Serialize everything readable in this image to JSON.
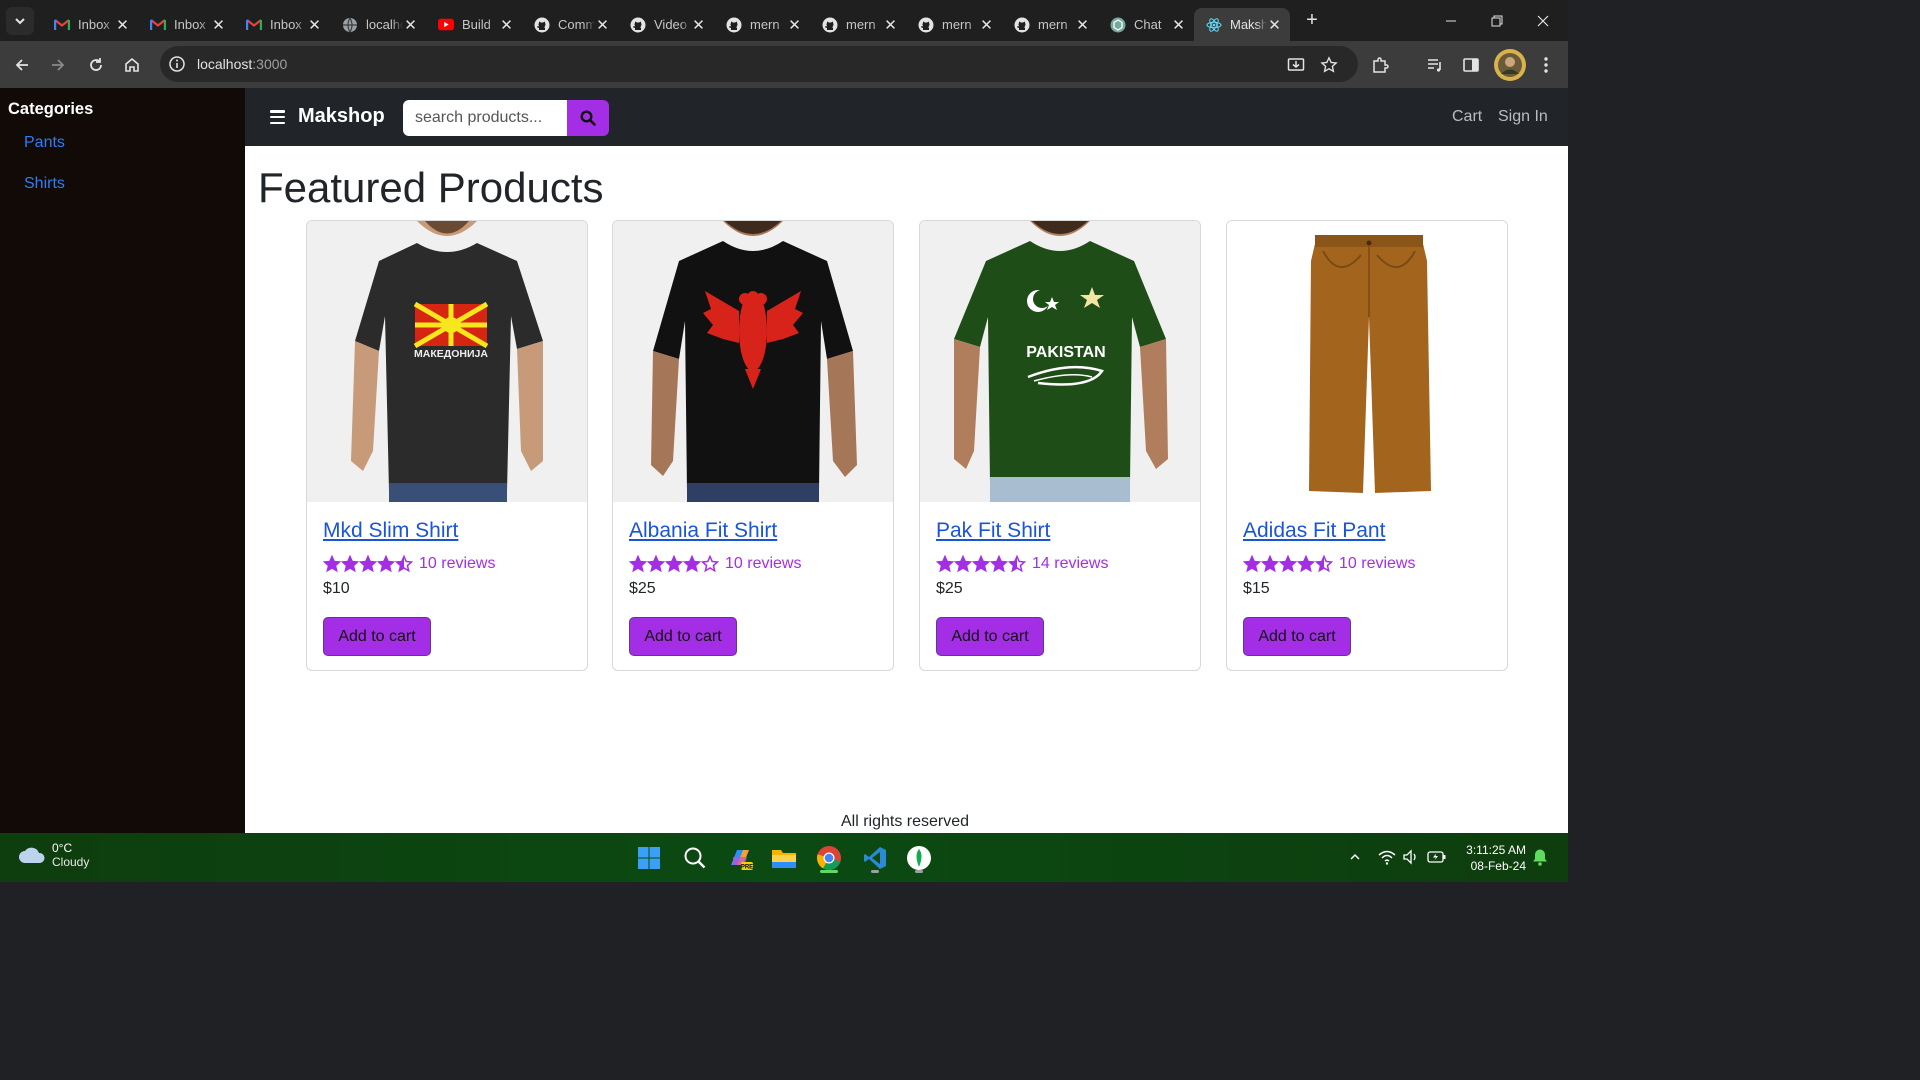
{
  "browser": {
    "tabs": [
      {
        "title": "Inbox",
        "icon": "gmail-icon",
        "active": false
      },
      {
        "title": "Inbox",
        "icon": "gmail-icon",
        "active": false
      },
      {
        "title": "Inbox",
        "icon": "gmail-icon",
        "active": false
      },
      {
        "title": "localhost",
        "icon": "globe-icon",
        "active": false
      },
      {
        "title": "Build",
        "icon": "youtube-icon",
        "active": false
      },
      {
        "title": "Commit",
        "icon": "github-icon",
        "active": false
      },
      {
        "title": "Video",
        "icon": "github-icon",
        "active": false
      },
      {
        "title": "mern",
        "icon": "github-icon",
        "active": false
      },
      {
        "title": "mern",
        "icon": "github-icon",
        "active": false
      },
      {
        "title": "mern",
        "icon": "github-icon",
        "active": false
      },
      {
        "title": "mern",
        "icon": "github-icon",
        "active": false
      },
      {
        "title": "Chat",
        "icon": "chatgpt-icon",
        "active": false
      },
      {
        "title": "Makshop",
        "icon": "react-icon",
        "active": true
      }
    ],
    "url_host": "localhost",
    "url_port": ":3000"
  },
  "sidebar": {
    "heading": "Categories",
    "items": [
      "Pants",
      "Shirts"
    ]
  },
  "navbar": {
    "brand": "Makshop",
    "search_placeholder": "search products...",
    "cart_label": "Cart",
    "signin_label": "Sign In"
  },
  "main": {
    "title": "Featured Products",
    "products": [
      {
        "name": "Mkd Slim Shirt",
        "rating": 4.5,
        "reviews": "10 reviews",
        "price": "$10",
        "button": "Add to cart",
        "image": "black-shirt-macedonia-flag",
        "print": "МАКЕДОНИЈА"
      },
      {
        "name": "Albania Fit Shirt",
        "rating": 4.0,
        "reviews": "10 reviews",
        "price": "$25",
        "button": "Add to cart",
        "image": "black-shirt-albania-eagle"
      },
      {
        "name": "Pak Fit Shirt",
        "rating": 4.5,
        "reviews": "14 reviews",
        "price": "$25",
        "button": "Add to cart",
        "image": "green-shirt-pakistan",
        "print": "PAKISTAN"
      },
      {
        "name": "Adidas Fit Pant",
        "rating": 4.5,
        "reviews": "10 reviews",
        "price": "$15",
        "button": "Add to cart",
        "image": "brown-pants"
      }
    ],
    "footer": "All rights reserved"
  },
  "taskbar": {
    "weather_temp": "0°C",
    "weather_desc": "Cloudy",
    "time": "3:11:25 AM",
    "date": "08-Feb-24",
    "apps": [
      "windows-start-icon",
      "search-icon",
      "copilot-icon",
      "file-explorer-icon",
      "chrome-icon",
      "vscode-icon",
      "mongodb-compass-icon"
    ]
  },
  "colors": {
    "accent": "#a42ee6",
    "link": "#1a55d7",
    "sidebar_bg": "#110a06",
    "navbar_bg": "#212529",
    "taskbar_bg": "#0b4a12"
  }
}
